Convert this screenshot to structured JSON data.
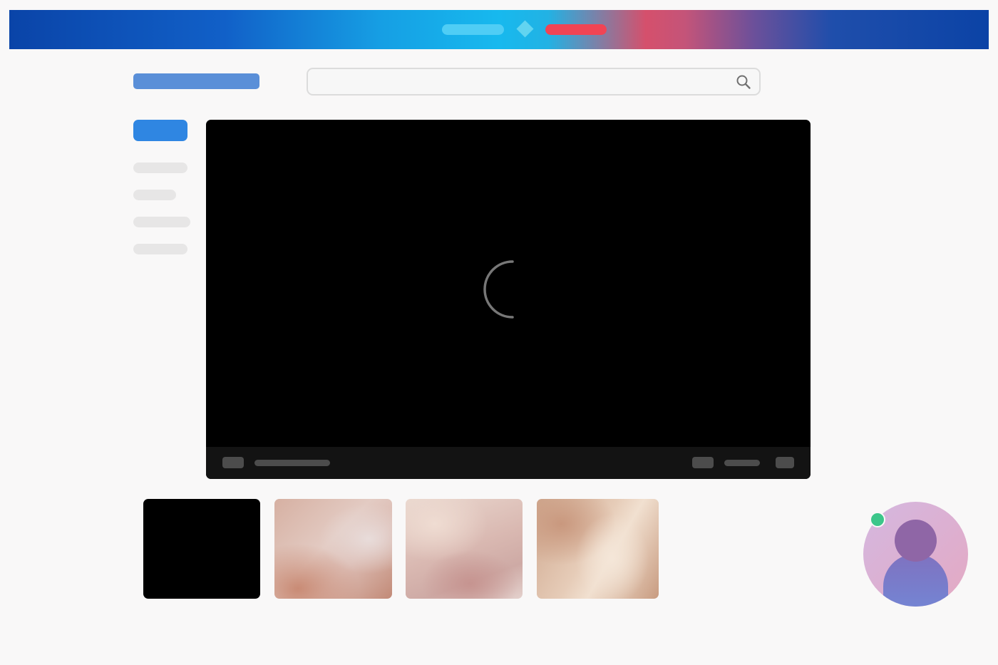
{
  "banner": {
    "colors": {
      "left_pill": "#4fcdf5",
      "center_diamond": "#62d4f0",
      "right_pill": "#f04454"
    }
  },
  "header": {
    "logo_color": "#5a8fd8",
    "search": {
      "placeholder": "",
      "value": "",
      "icon": "search-icon"
    }
  },
  "sidebar": {
    "active_color": "#2f86e2",
    "item_count": 5
  },
  "player": {
    "state": "loading",
    "spinner_icon": "loading-spinner-icon",
    "background": "#000000"
  },
  "thumbnails": [
    {
      "name": "thumbnail-1",
      "style": "black"
    },
    {
      "name": "thumbnail-2",
      "style": "peach-abstract"
    },
    {
      "name": "thumbnail-3",
      "style": "pink-abstract"
    },
    {
      "name": "thumbnail-4",
      "style": "cream-abstract"
    }
  ],
  "user": {
    "avatar_icon": "user-avatar-icon",
    "status": "online",
    "status_color": "#3cc68a"
  }
}
